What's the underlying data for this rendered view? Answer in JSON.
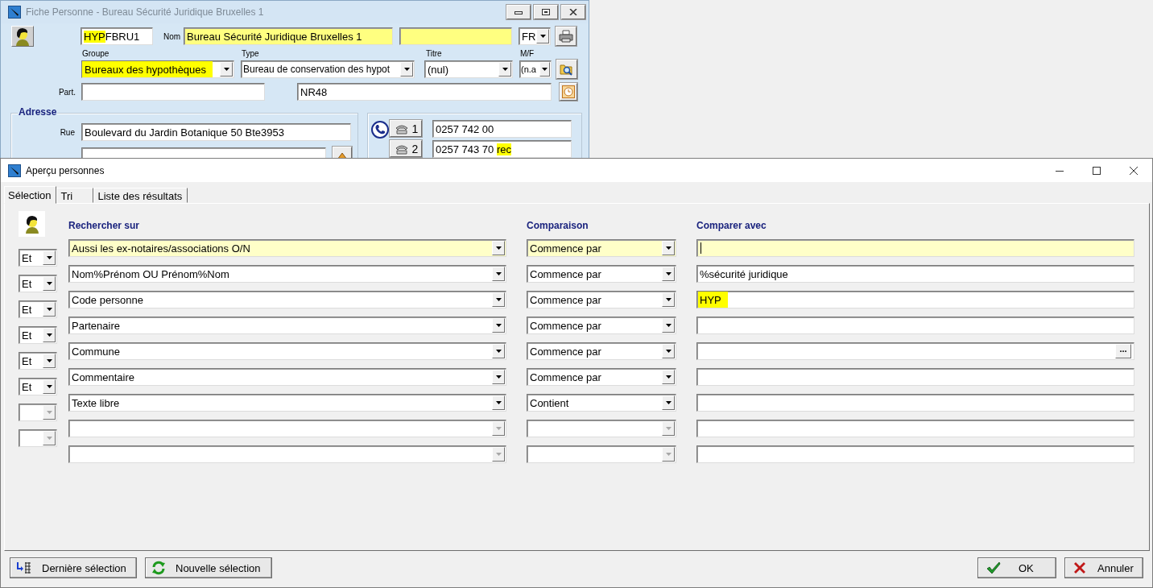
{
  "back_window": {
    "title": "Fiche Personne - Bureau Sécurité Juridique Bruxelles 1",
    "code_field": {
      "parts": [
        {
          "text": "HYP",
          "highlight": true
        },
        {
          "text": "FBRU1",
          "highlight": false
        }
      ]
    },
    "nom_label": "Nom",
    "nom_field": {
      "value": "Bureau Sécurité Juridique Bruxelles 1",
      "highlight": true
    },
    "extra_field": {
      "highlight": true
    },
    "language_combo": {
      "value": "FR",
      "highlight": false
    },
    "labels": [
      "Groupe",
      "Type",
      "Titre",
      "M/F"
    ],
    "groupe_combo": {
      "value": "Bureaux des hypothèques",
      "highlight": true
    },
    "type_combo": {
      "value": "Bureau de conservation des hypot",
      "highlight": false
    },
    "titre_combo": {
      "value": "(nul)",
      "highlight": false
    },
    "mf_combo": {
      "value": "(n.a",
      "highlight": false
    },
    "part_label": "Part.",
    "part_field": {
      "highlight": false
    },
    "ref_field": {
      "value": "NR48",
      "highlight": false
    },
    "address": {
      "title": "Adresse",
      "rue_label": "Rue",
      "rue_field": {
        "value": "Boulevard du Jardin Botanique 50 Bte3953",
        "highlight": false
      },
      "line2_field": {
        "highlight": false
      }
    },
    "phones": [
      {
        "button": "1",
        "parts": [
          {
            "text": "0257 742 00",
            "highlight": false
          }
        ]
      },
      {
        "button": "2",
        "parts": [
          {
            "text": "0257 743 70 ",
            "highlight": false
          },
          {
            "text": "rec",
            "highlight": true
          }
        ]
      }
    ]
  },
  "dialog": {
    "title": "Aperçu personnes",
    "tabs": [
      {
        "label": "Sélection",
        "selected": true
      },
      {
        "label": "Tri",
        "selected": false
      },
      {
        "label": "Liste des résultats",
        "selected": false
      }
    ],
    "headers": {
      "field": "Rechercher sur",
      "comparison": "Comparaison",
      "value": "Comparer avec"
    },
    "criteria": [
      {
        "current": true,
        "field": {
          "value": "Aussi les ex-notaires/associations O/N",
          "disabled": false
        },
        "comparison": {
          "value": "Commence par",
          "disabled": false
        },
        "input": {
          "kind": "text"
        }
      },
      {
        "current": false,
        "connector": {
          "value": "Et",
          "disabled": false
        },
        "field": {
          "value": "Nom%Prénom OU Prénom%Nom",
          "disabled": false
        },
        "comparison": {
          "value": "Commence par",
          "disabled": false
        },
        "input": {
          "kind": "text",
          "value": "%sécurité juridique",
          "highlight": false
        }
      },
      {
        "current": false,
        "connector": {
          "value": "Et",
          "disabled": false
        },
        "field": {
          "value": "Code personne",
          "disabled": false
        },
        "comparison": {
          "value": "Commence par",
          "disabled": false
        },
        "input": {
          "kind": "text",
          "value": "HYP",
          "highlight": true
        }
      },
      {
        "current": false,
        "connector": {
          "value": "Et",
          "disabled": false
        },
        "field": {
          "value": "Partenaire",
          "disabled": false
        },
        "comparison": {
          "value": "Commence par",
          "disabled": false
        },
        "input": {
          "kind": "text"
        }
      },
      {
        "current": false,
        "connector": {
          "value": "Et",
          "disabled": false
        },
        "field": {
          "value": "Commune",
          "disabled": false
        },
        "comparison": {
          "value": "Commence par",
          "disabled": false
        },
        "input": {
          "kind": "lookup",
          "button": "..."
        }
      },
      {
        "current": false,
        "connector": {
          "value": "Et",
          "disabled": false
        },
        "field": {
          "value": "Commentaire",
          "disabled": false
        },
        "comparison": {
          "value": "Commence par",
          "disabled": false
        },
        "input": {
          "kind": "text"
        }
      },
      {
        "current": false,
        "connector": {
          "value": "Et",
          "disabled": false
        },
        "field": {
          "value": "Texte libre",
          "disabled": false
        },
        "comparison": {
          "value": "Contient",
          "disabled": false
        },
        "input": {
          "kind": "text"
        }
      },
      {
        "current": false,
        "connector": {
          "disabled": true
        },
        "field": {
          "disabled": true
        },
        "comparison": {
          "disabled": true
        },
        "input": {
          "kind": "text"
        }
      },
      {
        "current": false,
        "connector": {
          "disabled": true
        },
        "field": {
          "disabled": true
        },
        "comparison": {
          "disabled": true
        },
        "input": {
          "kind": "text"
        }
      }
    ],
    "buttons": [
      {
        "label": "Dernière sélection",
        "kind": "last"
      },
      {
        "label": "Nouvelle sélection",
        "kind": "new"
      },
      {
        "label": "OK",
        "kind": "ok"
      },
      {
        "label": "Annuler",
        "kind": "cancel"
      }
    ]
  }
}
